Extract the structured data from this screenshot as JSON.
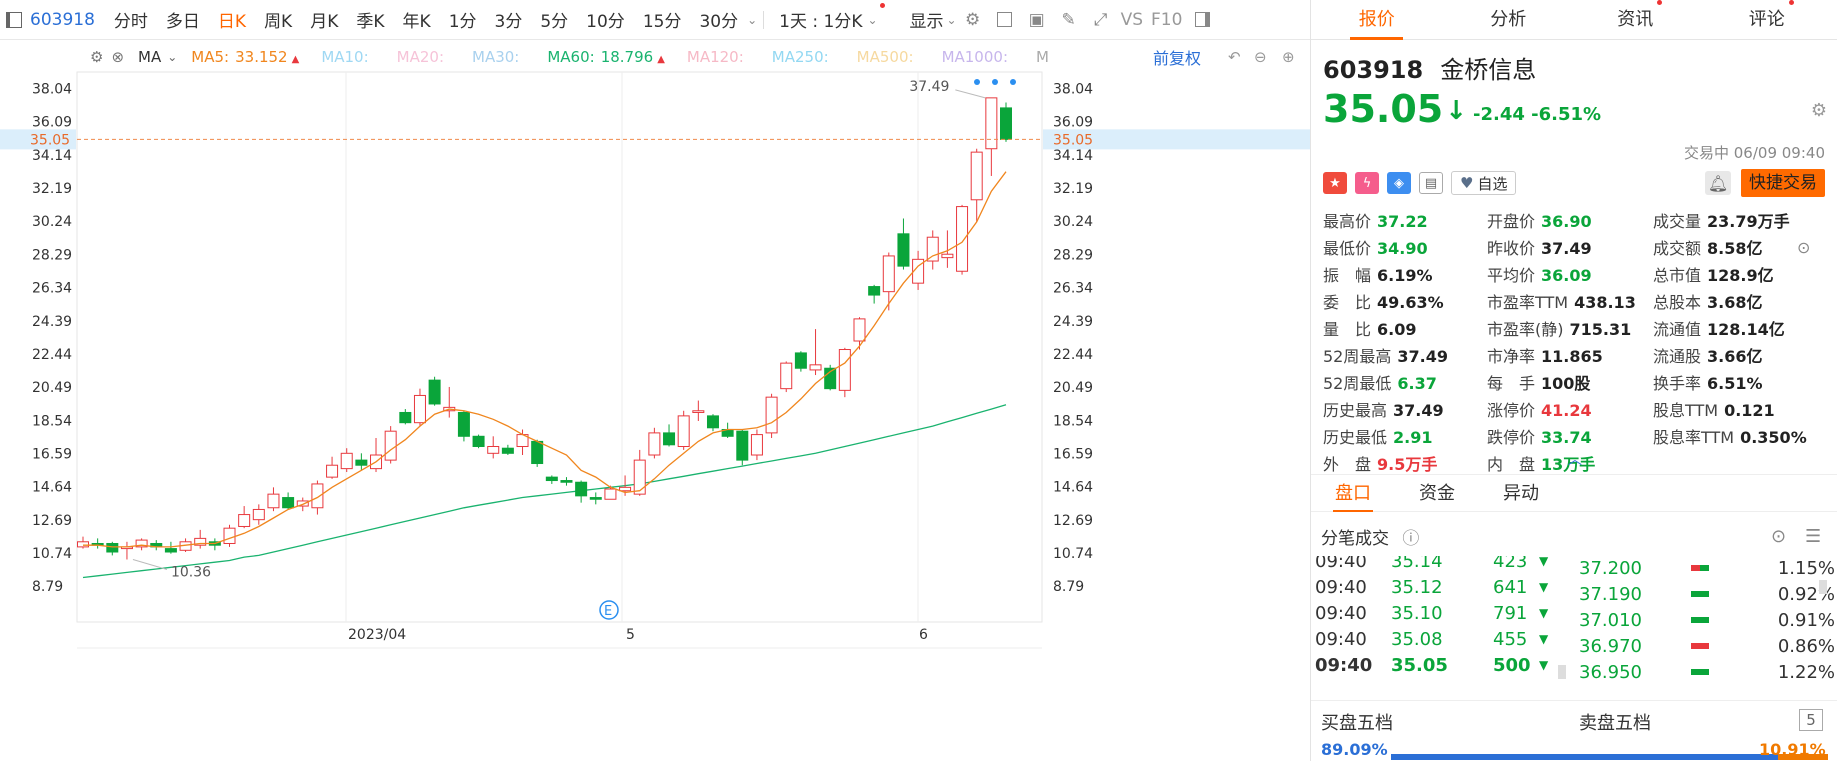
{
  "toolbar": {
    "code": "603918",
    "periods": [
      "分时",
      "多日",
      "日K",
      "周K",
      "月K",
      "季K",
      "年K",
      "1分",
      "3分",
      "5分",
      "10分",
      "15分",
      "30分"
    ],
    "active_period": "日K",
    "multi_day": "1天 : 1分K",
    "display": "显示",
    "vs": "VS",
    "f10": "F10"
  },
  "ma_bar": {
    "ma_label": "MA",
    "items": [
      {
        "name": "MA5:",
        "value": "33.152",
        "color": "#f0861e",
        "arrow": "up"
      },
      {
        "name": "MA10:",
        "value": "",
        "color": "#9fd8f3"
      },
      {
        "name": "MA20:",
        "value": "",
        "color": "#f6c3d8"
      },
      {
        "name": "MA30:",
        "value": "",
        "color": "#a9d1ee"
      },
      {
        "name": "MA60:",
        "value": "18.796",
        "color": "#1ab36f",
        "arrow": "up"
      },
      {
        "name": "MA120:",
        "value": "",
        "color": "#f6b9c6"
      },
      {
        "name": "MA250:",
        "value": "",
        "color": "#93d8f2"
      },
      {
        "name": "MA500:",
        "value": "",
        "color": "#f6d9a0"
      },
      {
        "name": "MA1000:",
        "value": "",
        "color": "#c7b6ec"
      },
      {
        "name": "M",
        "value": "",
        "color": "#aaa"
      }
    ],
    "adjust": "前复权"
  },
  "chart_data": {
    "type": "candlestick",
    "y_ticks": [
      "38.04",
      "36.09",
      "34.14",
      "32.19",
      "30.24",
      "28.29",
      "26.34",
      "24.39",
      "22.44",
      "20.49",
      "18.54",
      "16.59",
      "14.64",
      "12.69",
      "10.74",
      "8.79"
    ],
    "x_labels": [
      "2023/04",
      "5",
      "6"
    ],
    "current_price_line": "35.05",
    "high_annotation": "37.49",
    "low_annotation": "10.36",
    "event_marker": "E",
    "candles": [
      [
        11.1,
        11.7,
        11.0,
        11.4
      ],
      [
        11.3,
        11.6,
        11.0,
        11.2
      ],
      [
        11.3,
        11.4,
        10.6,
        10.8
      ],
      [
        11.0,
        11.4,
        10.36,
        11.1
      ],
      [
        11.1,
        11.6,
        10.9,
        11.5
      ],
      [
        11.3,
        11.5,
        10.9,
        11.1
      ],
      [
        11.0,
        11.4,
        10.7,
        10.8
      ],
      [
        10.9,
        11.6,
        10.8,
        11.4
      ],
      [
        11.2,
        12.1,
        11.0,
        11.6
      ],
      [
        11.4,
        11.6,
        10.9,
        11.2
      ],
      [
        11.3,
        12.4,
        11.1,
        12.2
      ],
      [
        12.3,
        13.5,
        12.2,
        13.0
      ],
      [
        12.7,
        13.6,
        12.4,
        13.3
      ],
      [
        13.4,
        14.6,
        13.2,
        14.2
      ],
      [
        14.0,
        14.3,
        13.3,
        13.4
      ],
      [
        13.5,
        14.0,
        13.2,
        13.8
      ],
      [
        13.4,
        15.0,
        13.0,
        14.8
      ],
      [
        15.2,
        16.4,
        15.1,
        15.9
      ],
      [
        15.7,
        16.9,
        15.5,
        16.6
      ],
      [
        16.2,
        16.6,
        15.6,
        15.9
      ],
      [
        15.7,
        17.5,
        15.5,
        16.5
      ],
      [
        16.2,
        18.2,
        16.0,
        17.9
      ],
      [
        19.0,
        19.2,
        18.3,
        18.4
      ],
      [
        18.4,
        20.4,
        18.2,
        20.0
      ],
      [
        20.9,
        21.1,
        19.4,
        19.5
      ],
      [
        19.1,
        20.5,
        18.7,
        19.3
      ],
      [
        19.0,
        19.1,
        17.3,
        17.6
      ],
      [
        17.6,
        17.7,
        16.9,
        17.0
      ],
      [
        16.6,
        17.6,
        16.3,
        17.0
      ],
      [
        16.9,
        17.1,
        16.5,
        16.6
      ],
      [
        17.0,
        18.0,
        16.5,
        17.7
      ],
      [
        17.3,
        17.4,
        15.8,
        16.0
      ],
      [
        15.2,
        15.3,
        14.8,
        15.0
      ],
      [
        15.0,
        15.2,
        14.7,
        14.9
      ],
      [
        14.9,
        15.0,
        13.7,
        14.1
      ],
      [
        14.0,
        14.3,
        13.6,
        13.9
      ],
      [
        13.9,
        14.7,
        13.9,
        14.5
      ],
      [
        14.4,
        15.3,
        14.1,
        14.6
      ],
      [
        14.2,
        16.8,
        14.1,
        16.2
      ],
      [
        16.5,
        18.1,
        16.3,
        17.8
      ],
      [
        17.8,
        18.3,
        17.0,
        17.1
      ],
      [
        17.0,
        19.1,
        16.8,
        18.8
      ],
      [
        19.0,
        19.7,
        18.5,
        19.1
      ],
      [
        18.8,
        18.9,
        17.9,
        18.1
      ],
      [
        18.0,
        18.4,
        17.5,
        17.6
      ],
      [
        17.9,
        18.0,
        15.9,
        16.2
      ],
      [
        16.5,
        18.0,
        16.2,
        17.7
      ],
      [
        17.8,
        20.1,
        17.5,
        19.9
      ],
      [
        20.4,
        22.0,
        20.2,
        21.9
      ],
      [
        22.5,
        22.6,
        21.4,
        21.6
      ],
      [
        21.5,
        23.9,
        21.2,
        21.8
      ],
      [
        21.6,
        21.8,
        20.3,
        20.4
      ],
      [
        20.3,
        22.8,
        19.9,
        22.7
      ],
      [
        23.2,
        24.6,
        22.7,
        24.5
      ],
      [
        26.4,
        26.5,
        25.4,
        25.9
      ],
      [
        26.1,
        28.4,
        25.0,
        28.2
      ],
      [
        29.5,
        30.4,
        27.4,
        27.6
      ],
      [
        26.6,
        28.5,
        26.2,
        28.0
      ],
      [
        27.9,
        29.7,
        27.4,
        29.3
      ],
      [
        28.1,
        29.7,
        27.5,
        28.3
      ],
      [
        27.3,
        31.2,
        27.1,
        31.1
      ],
      [
        31.5,
        34.5,
        30.2,
        34.3
      ],
      [
        34.5,
        37.49,
        32.9,
        37.49
      ],
      [
        36.9,
        37.22,
        34.9,
        35.05
      ]
    ],
    "ma5": [
      11.2,
      11.2,
      11.1,
      11.1,
      11.2,
      11.1,
      11.1,
      11.2,
      11.3,
      11.3,
      11.6,
      11.9,
      12.3,
      12.8,
      13.3,
      13.6,
      14.0,
      14.6,
      15.1,
      15.6,
      16.1,
      16.8,
      17.4,
      18.2,
      18.9,
      19.2,
      19.1,
      18.9,
      18.6,
      18.2,
      17.7,
      17.3,
      16.9,
      16.5,
      15.6,
      15.2,
      14.6,
      14.3,
      14.4,
      15.1,
      15.9,
      16.6,
      17.3,
      17.8,
      18.0,
      18.0,
      18.1,
      18.4,
      19.0,
      19.8,
      20.7,
      21.4,
      21.9,
      22.9,
      24.1,
      25.4,
      26.6,
      27.6,
      28.2,
      28.5,
      29.0,
      30.2,
      32.0,
      33.15
    ],
    "ma60": [
      9.3,
      9.4,
      9.5,
      9.6,
      9.7,
      9.8,
      9.9,
      10.0,
      10.1,
      10.2,
      10.3,
      10.5,
      10.6,
      10.8,
      11.0,
      11.2,
      11.4,
      11.6,
      11.8,
      12.0,
      12.2,
      12.4,
      12.6,
      12.8,
      13.0,
      13.2,
      13.4,
      13.55,
      13.7,
      13.85,
      14.0,
      14.1,
      14.2,
      14.3,
      14.4,
      14.5,
      14.6,
      14.7,
      14.8,
      14.95,
      15.1,
      15.25,
      15.4,
      15.55,
      15.7,
      15.85,
      16.0,
      16.15,
      16.3,
      16.45,
      16.6,
      16.8,
      17.0,
      17.2,
      17.4,
      17.6,
      17.8,
      18.0,
      18.2,
      18.45,
      18.7,
      18.95,
      19.2,
      19.45
    ]
  },
  "stock": {
    "code": "603918",
    "name": "金桥信息",
    "price": "35.05",
    "change": "-2.44",
    "change_pct": "-6.51%",
    "status": "交易中 06/09 09:40",
    "watch": "自选",
    "trade_button": "快捷交易"
  },
  "tabs": [
    {
      "label": "报价",
      "active": true,
      "dot": false
    },
    {
      "label": "分析",
      "active": false,
      "dot": false
    },
    {
      "label": "资讯",
      "active": false,
      "dot": true
    },
    {
      "label": "评论",
      "active": false,
      "dot": true
    }
  ],
  "stats": [
    [
      {
        "l": "最高价",
        "v": "37.22",
        "c": "green"
      },
      {
        "l": "开盘价",
        "v": "36.90",
        "c": "green"
      },
      {
        "l": "成交量",
        "v": "23.79万手",
        "c": "dark"
      }
    ],
    [
      {
        "l": "最低价",
        "v": "34.90",
        "c": "green"
      },
      {
        "l": "昨收价",
        "v": "37.49",
        "c": "dark"
      },
      {
        "l": "成交额",
        "v": "8.58亿",
        "c": "dark"
      }
    ],
    [
      {
        "l": "振　幅",
        "v": "6.19%",
        "c": "dark"
      },
      {
        "l": "平均价",
        "v": "36.09",
        "c": "green"
      },
      {
        "l": "总市值",
        "v": "128.9亿",
        "c": "dark"
      }
    ],
    [
      {
        "l": "委　比",
        "v": "49.63%",
        "c": "dark"
      },
      {
        "l": "市盈率TTM",
        "v": "438.13",
        "c": "dark"
      },
      {
        "l": "总股本",
        "v": "3.68亿",
        "c": "dark"
      }
    ],
    [
      {
        "l": "量　比",
        "v": "6.09",
        "c": "dark"
      },
      {
        "l": "市盈率(静)",
        "v": "715.31",
        "c": "dark"
      },
      {
        "l": "流通值",
        "v": "128.14亿",
        "c": "dark"
      }
    ],
    [
      {
        "l": "52周最高",
        "v": "37.49",
        "c": "dark"
      },
      {
        "l": "市净率",
        "v": "11.865",
        "c": "dark"
      },
      {
        "l": "流通股",
        "v": "3.66亿",
        "c": "dark"
      }
    ],
    [
      {
        "l": "52周最低",
        "v": "6.37",
        "c": "green"
      },
      {
        "l": "每　手",
        "v": "100股",
        "c": "dark"
      },
      {
        "l": "换手率",
        "v": "6.51%",
        "c": "dark"
      }
    ],
    [
      {
        "l": "历史最高",
        "v": "37.49",
        "c": "dark"
      },
      {
        "l": "涨停价",
        "v": "41.24",
        "c": "red"
      },
      {
        "l": "股息TTM",
        "v": "0.121",
        "c": "dark"
      }
    ],
    [
      {
        "l": "历史最低",
        "v": "2.91",
        "c": "green"
      },
      {
        "l": "跌停价",
        "v": "33.74",
        "c": "green"
      },
      {
        "l": "股息率TTM",
        "v": "0.350%",
        "c": "dark"
      }
    ],
    [
      {
        "l": "外　盘",
        "v": "9.5万手",
        "c": "red"
      },
      {
        "l": "内　盘",
        "v": "13万手",
        "c": "green"
      }
    ]
  ],
  "pankou_tabs": [
    "盘口",
    "资金",
    "异动"
  ],
  "ticks_title": "分笔成交",
  "ticks": [
    {
      "t": "09:40",
      "p": "35.14",
      "v": "423"
    },
    {
      "t": "09:40",
      "p": "35.12",
      "v": "641"
    },
    {
      "t": "09:40",
      "p": "35.10",
      "v": "791"
    },
    {
      "t": "09:40",
      "p": "35.08",
      "v": "455"
    },
    {
      "t": "09:40",
      "p": "35.05",
      "v": "500"
    }
  ],
  "levels": [
    {
      "p": "37.200",
      "r": "1.15%",
      "c": "mix"
    },
    {
      "p": "37.190",
      "r": "0.92%",
      "c": "green"
    },
    {
      "p": "37.010",
      "r": "0.91%",
      "c": "green"
    },
    {
      "p": "36.970",
      "r": "0.86%",
      "c": "red"
    },
    {
      "p": "36.950",
      "r": "1.22%",
      "c": "green"
    }
  ],
  "five": {
    "buy": "买盘五档",
    "sell": "卖盘五档",
    "count": "5"
  },
  "bid_ratio": {
    "buy": "89.09%",
    "sell": "10.91%"
  }
}
